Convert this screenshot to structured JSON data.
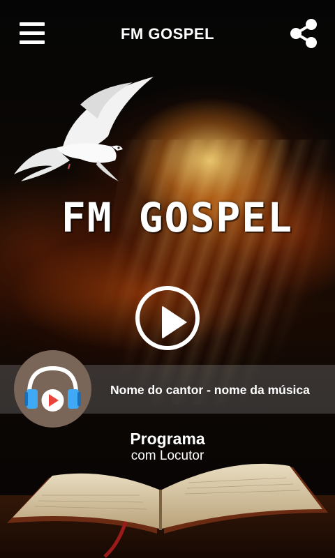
{
  "header": {
    "title": "FM GOSPEL",
    "menu_icon": "hamburger-menu-icon",
    "share_icon": "share-icon"
  },
  "hero": {
    "logo_text": "FM GOSPEL",
    "image": "dove-and-light-rays"
  },
  "player": {
    "play_icon": "play-icon",
    "now_playing": "Nome do cantor - nome da música",
    "cover_icon": "headphones-play-icon",
    "cover_color": "#7a6658"
  },
  "program": {
    "name": "Programa",
    "host": "com Locutor"
  },
  "colors": {
    "text": "#ffffff",
    "bar": "rgba(120,120,120,0.38)"
  }
}
